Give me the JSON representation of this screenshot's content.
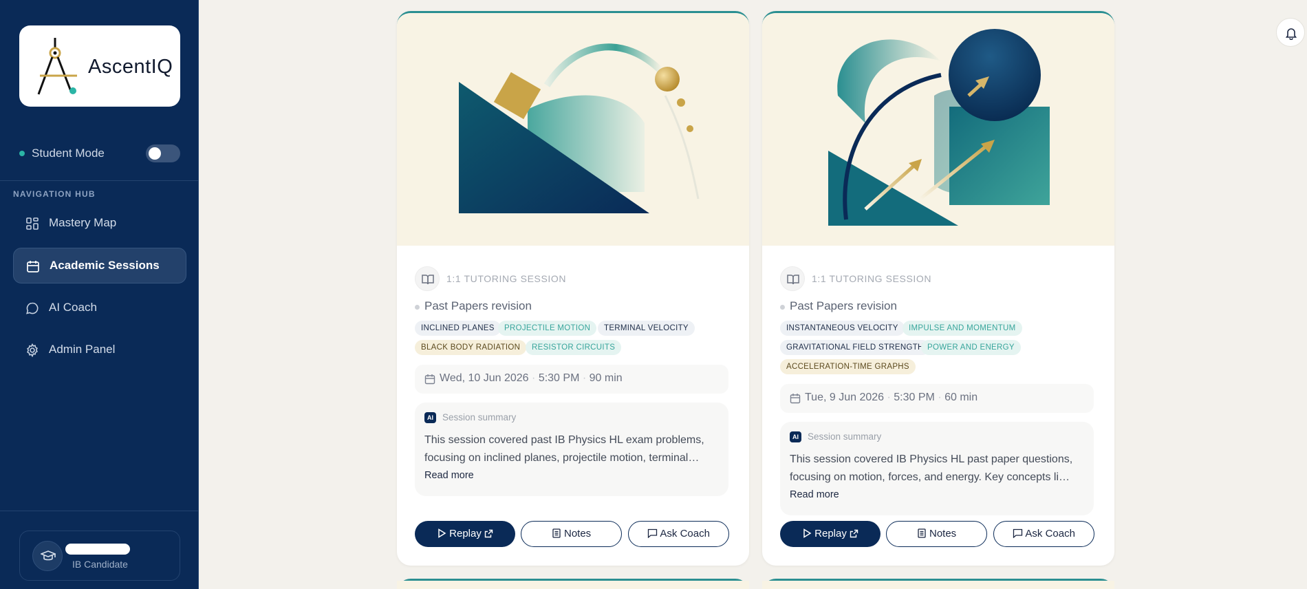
{
  "app": {
    "logo_text": "AscentIQ",
    "mode_label": "Student Mode",
    "nav_heading": "NAVIGATION HUB",
    "nav_items": [
      {
        "label": "Mastery Map",
        "icon": "grid-icon",
        "active": false
      },
      {
        "label": "Academic Sessions",
        "icon": "calendar-icon",
        "active": true
      },
      {
        "label": "AI Coach",
        "icon": "chat-bubble-icon",
        "active": false
      },
      {
        "label": "Admin Panel",
        "icon": "gear-icon",
        "active": false
      }
    ],
    "profile": {
      "role": "IB Candidate"
    },
    "colors": {
      "sidebar": "#0a2a57",
      "teal_accent": "#2bb5a6",
      "gold_accent": "#c9a448"
    }
  },
  "sessions": [
    {
      "type": "1:1 TUTORING SESSION",
      "topic": "Past Papers revision",
      "tags": [
        {
          "label": "INCLINED PLANES",
          "style": "navy"
        },
        {
          "label": "PROJECTILE MOTION",
          "style": "teal"
        },
        {
          "label": "TERMINAL VELOCITY",
          "style": "navy"
        },
        {
          "label": "BLACK BODY RADIATION",
          "style": "gold"
        },
        {
          "label": "RESISTOR CIRCUITS",
          "style": "teal"
        }
      ],
      "date": "Wed, 10 Jun 2026",
      "time": "5:30 PM",
      "duration": "90 min",
      "summary_title": "Session summary",
      "summary_badge": "AI",
      "summary_lines": [
        "This session covered past IB Physics HL exam problems,",
        "focusing on inclined planes, projectile motion, terminal…"
      ],
      "read_more": "Read more",
      "buttons": {
        "replay": "Replay",
        "notes": "Notes",
        "ask_coach": "Ask Coach"
      }
    },
    {
      "type": "1:1 TUTORING SESSION",
      "topic": "Past Papers revision",
      "tags": [
        {
          "label": "INSTANTANEOUS VELOCITY",
          "style": "navy"
        },
        {
          "label": "IMPULSE AND MOMENTUM",
          "style": "teal"
        },
        {
          "label": "GRAVITATIONAL FIELD STRENGTH",
          "style": "navy"
        },
        {
          "label": "POWER AND ENERGY",
          "style": "teal"
        },
        {
          "label": "ACCELERATION-TIME GRAPHS",
          "style": "gold"
        }
      ],
      "date": "Tue, 9 Jun 2026",
      "time": "5:30 PM",
      "duration": "60 min",
      "summary_title": "Session summary",
      "summary_badge": "AI",
      "summary_lines": [
        "This session covered IB Physics HL past paper questions,",
        "focusing on motion, forces, and energy. Key concepts li…"
      ],
      "read_more": "Read more",
      "buttons": {
        "replay": "Replay",
        "notes": "Notes",
        "ask_coach": "Ask Coach"
      }
    }
  ]
}
